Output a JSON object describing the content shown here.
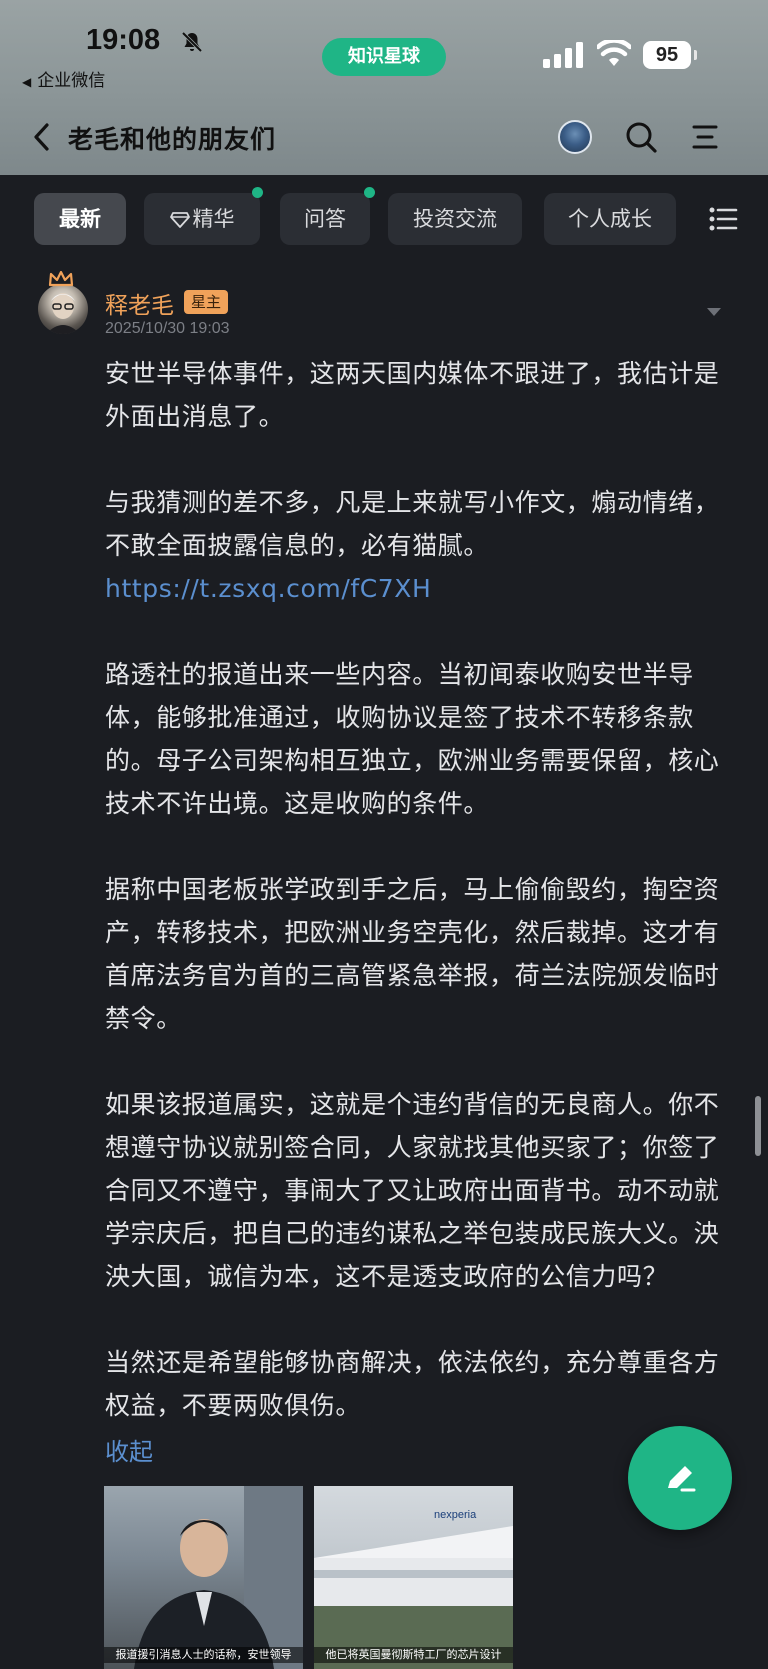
{
  "status_bar": {
    "time": "19:08",
    "back_app": "企业微信",
    "app_pill": "知识星球",
    "battery": "95"
  },
  "nav": {
    "title": "老毛和他的朋友们"
  },
  "tabs": [
    {
      "label": "最新",
      "active": true
    },
    {
      "label": "精华",
      "dot": true,
      "icon": "gem-icon"
    },
    {
      "label": "问答",
      "dot": true
    },
    {
      "label": "投资交流"
    },
    {
      "label": "个人成长"
    }
  ],
  "post": {
    "author": "释老毛",
    "badge": "星主",
    "time": "2025/10/30 19:03",
    "paragraphs": [
      {
        "text": "安世半导体事件，这两天国内媒体不跟进了，我估计是外面出消息了。"
      },
      {
        "text": "与我猜测的差不多，凡是上来就写小作文，煽动情绪，不敢全面披露信息的，必有猫腻。",
        "link": "https://t.zsxq.com/fC7XH"
      },
      {
        "text": "路透社的报道出来一些内容。当初闻泰收购安世半导体，能够批准通过，收购协议是签了技术不转移条款的。母子公司架构相互独立，欧洲业务需要保留，核心技术不许出境。这是收购的条件。"
      },
      {
        "text": "据称中国老板张学政到手之后，马上偷偷毁约，掏空资产，转移技术，把欧洲业务空壳化，然后裁掉。这才有首席法务官为首的三高管紧急举报，荷兰法院颁发临时禁令。"
      },
      {
        "text": "如果该报道属实，这就是个违约背信的无良商人。你不想遵守协议就别签合同，人家就找其他买家了；你签了合同又不遵守，事闹大了又让政府出面背书。动不动就学宗庆后，把自己的违约谋私之举包装成民族大义。泱泱大国，诚信为本，这不是透支政府的公信力吗？"
      },
      {
        "text": "当然还是希望能够协商解决，依法依约，充分尊重各方权益，不要两败俱伤。"
      }
    ],
    "collapse_label": "收起",
    "images": [
      {
        "caption": "报道援引消息人士的话称，安世领导"
      },
      {
        "caption": "他已将英国曼彻斯特工厂的芯片设计"
      }
    ]
  }
}
